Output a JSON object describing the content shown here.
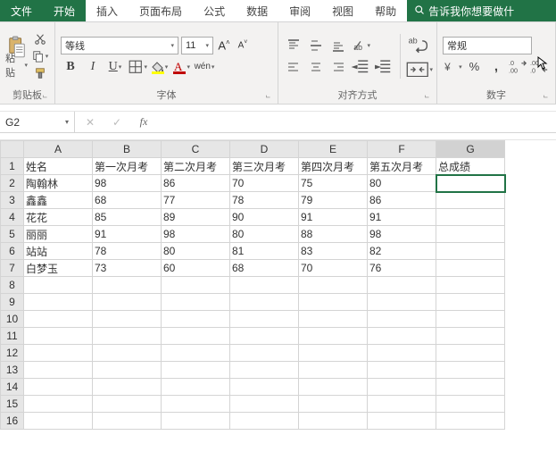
{
  "tabs": {
    "file": "文件",
    "home": "开始",
    "insert": "插入",
    "page_layout": "页面布局",
    "formulas": "公式",
    "data": "数据",
    "review": "审阅",
    "view": "视图",
    "help": "帮助",
    "tell_me": "告诉我你想要做什"
  },
  "ribbon": {
    "clipboard": {
      "label": "剪贴板",
      "paste": "粘贴"
    },
    "font": {
      "label": "字体",
      "name": "等线",
      "size": "11",
      "grow": "A",
      "shrink": "A",
      "bold": "B",
      "italic": "I",
      "underline": "U",
      "phonetic": "wén"
    },
    "alignment": {
      "label": "对齐方式",
      "wrap_label": "ab"
    },
    "number": {
      "label": "数字",
      "format": "常规"
    }
  },
  "formula_bar": {
    "name_box": "G2",
    "cancel": "✕",
    "enter": "✓",
    "fx": "fx",
    "formula": ""
  },
  "grid": {
    "columns": [
      "A",
      "B",
      "C",
      "D",
      "E",
      "F",
      "G"
    ],
    "row_count": 16,
    "selected_cell": {
      "row": 2,
      "col": "G"
    },
    "data": {
      "1": {
        "A": "姓名",
        "B": "第一次月考",
        "C": "第二次月考",
        "D": "第三次月考",
        "E": "第四次月考",
        "F": "第五次月考",
        "G": "总成绩"
      },
      "2": {
        "A": "陶翰林",
        "B": "98",
        "C": "86",
        "D": "70",
        "E": "75",
        "F": "80"
      },
      "3": {
        "A": "鑫鑫",
        "B": "68",
        "C": "77",
        "D": "78",
        "E": "79",
        "F": "86"
      },
      "4": {
        "A": "花花",
        "B": "85",
        "C": "89",
        "D": "90",
        "E": "91",
        "F": "91"
      },
      "5": {
        "A": "丽丽",
        "B": "91",
        "C": "98",
        "D": "80",
        "E": "88",
        "F": "98"
      },
      "6": {
        "A": "站站",
        "B": "78",
        "C": "80",
        "D": "81",
        "E": "83",
        "F": "82"
      },
      "7": {
        "A": "白梦玉",
        "B": "73",
        "C": "60",
        "D": "68",
        "E": "70",
        "F": "76"
      }
    }
  },
  "colors": {
    "accent": "#217346",
    "font_color": "#c00000",
    "fill_color": "#ffff00"
  }
}
